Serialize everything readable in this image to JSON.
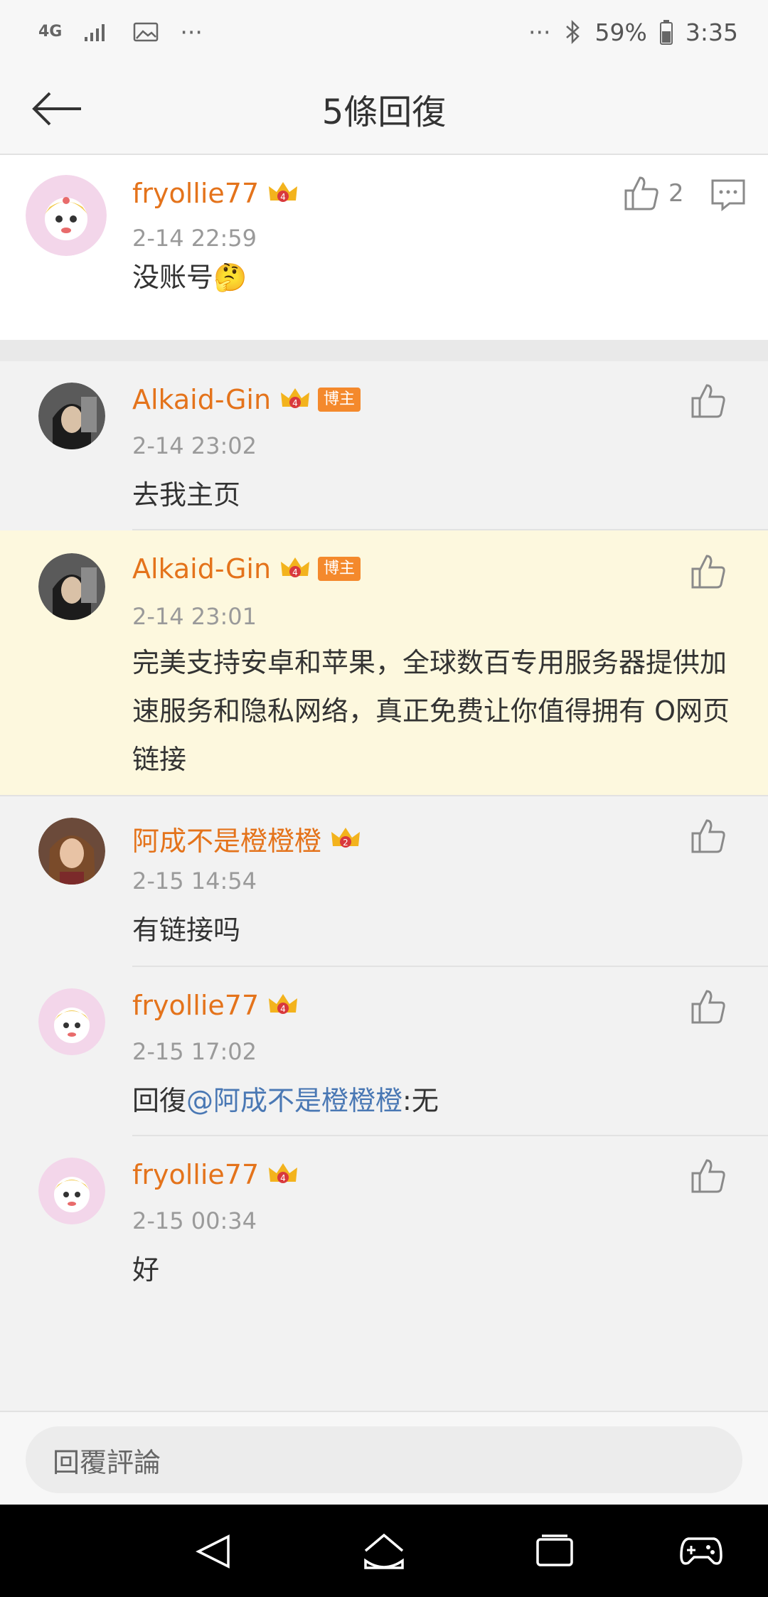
{
  "status": {
    "network": "4G",
    "battery": "59%",
    "time": "3:35",
    "more": "···"
  },
  "header": {
    "title": "5條回復"
  },
  "main": {
    "username": "fryollie77",
    "time": "2-14 22:59",
    "text": "没账号",
    "emoji": "🤔",
    "like_count": "2"
  },
  "replies": [
    {
      "username": "Alkaid-Gin",
      "badge": "博主",
      "time": "2-14 23:02",
      "text": "去我主页",
      "highlighted": false
    },
    {
      "username": "Alkaid-Gin",
      "badge": "博主",
      "time": "2-14 23:01",
      "text": "完美支持安卓和苹果，全球数百专用服务器提供加速服务和隐私网络，真正免费让你值得拥有 O网页链接",
      "highlighted": true
    },
    {
      "username": "阿成不是橙橙橙",
      "time": "2-15 14:54",
      "text": "有链接吗",
      "highlighted": false
    },
    {
      "username": "fryollie77",
      "time": "2-15 17:02",
      "text_prefix": "回復",
      "mention": "@阿成不是橙橙橙",
      "text_suffix": ":无",
      "highlighted": false
    },
    {
      "username": "fryollie77",
      "time": "2-15 00:34",
      "text": "好",
      "highlighted": false
    }
  ],
  "input": {
    "placeholder": "回覆評論"
  },
  "colors": {
    "username": "#e4731b",
    "mention": "#4a78b4",
    "highlight": "#fdf8de",
    "badge": "#f4892c"
  }
}
